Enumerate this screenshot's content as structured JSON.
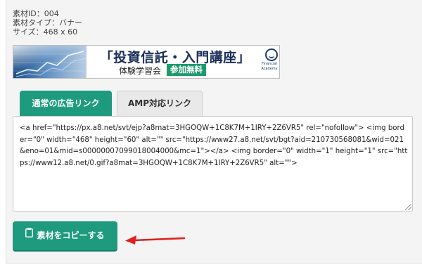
{
  "meta": {
    "id_line": "素材ID：004",
    "type_line": "素材タイプ：バナー",
    "size_line": "サイズ：468 x 60"
  },
  "banner": {
    "title": "「投資信託・入門講座」",
    "subtitle": "体験学習会",
    "badge": "参加無料",
    "logo_text_1": "Financial",
    "logo_text_2": "Academy"
  },
  "tabs": [
    {
      "label": "通常の広告リンク",
      "active": true
    },
    {
      "label": "AMP対応リンク",
      "active": false
    }
  ],
  "code_text": "<a href=\"https://px.a8.net/svt/ejp?a8mat=3HGOQW+1C8K7M+1IRY+2Z6VR5\" rel=\"nofollow\"> <img border=\"0\" width=\"468\" height=\"60\" alt=\"\" src=\"https://www27.a8.net/svt/bgt?aid=210730568081&wid=021&eno=01&mid=s00000007099018004000&mc=1\"></a> <img border=\"0\" width=\"1\" height=\"1\" src=\"https://www12.a8.net/0.gif?a8mat=3HGOQW+1C8K7M+1IRY+2Z6VR5\" alt=\"\">",
  "copy_button": {
    "label": "素材をコピーする",
    "icon": "clipboard-icon"
  },
  "colors": {
    "accent": "#1e9b7f",
    "arrow": "#e02020",
    "badge": "#1d9a6c"
  }
}
